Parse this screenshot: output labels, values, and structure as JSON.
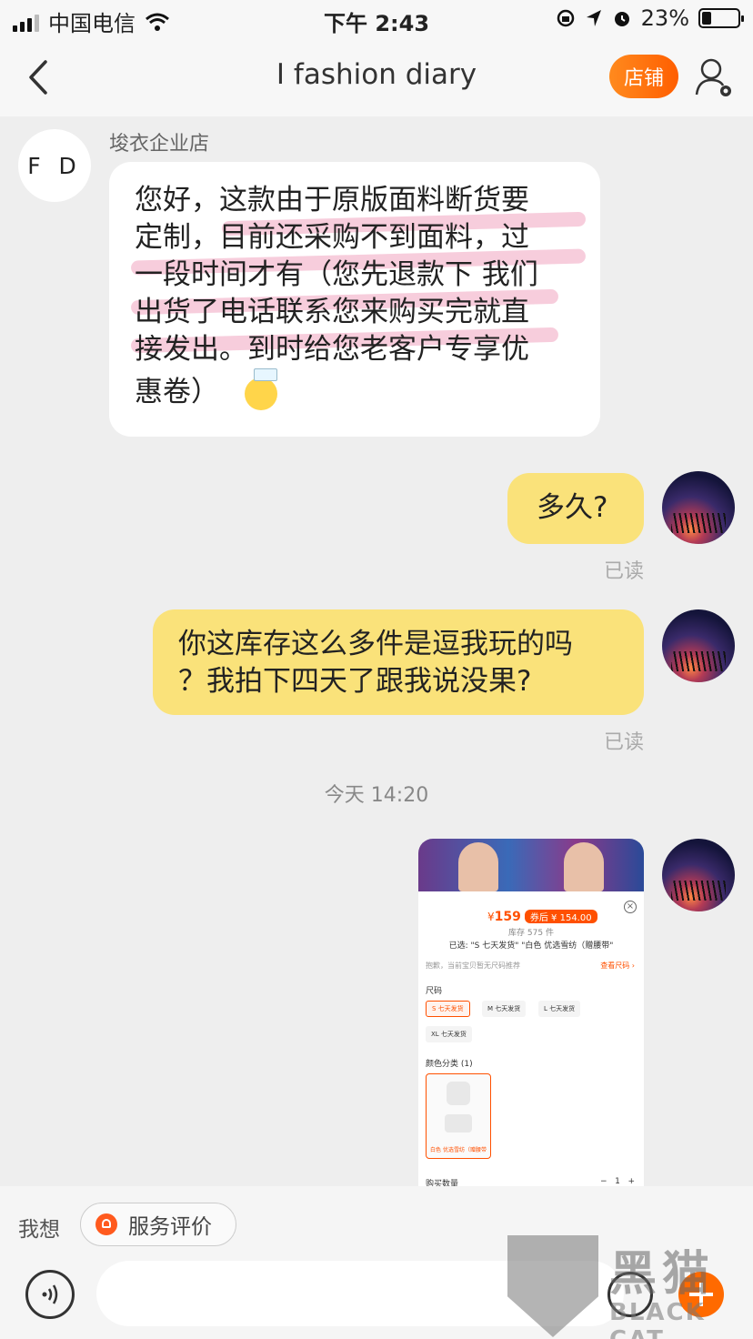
{
  "status_bar": {
    "carrier": "中国电信",
    "time": "下午 2:43",
    "battery": "23%"
  },
  "header": {
    "title": "I fashion diary",
    "shop_button": "店铺"
  },
  "messages": {
    "seller_avatar_text": "F D",
    "seller_name": "埈衣企业店",
    "seller_message_lines": [
      "您好，这款由于原版面料断货要",
      "定制，目前还采购不到面料，过",
      "一段时间才有（您先退款下 我们",
      "出货了电话联系您来购买完就直",
      "接发出。到时给您老客户专享优",
      "惠卷）"
    ],
    "reply1": "多久?",
    "reply1_status": "已读",
    "reply2_lines": [
      "你这库存这么多件是逗我玩的吗",
      "？我拍下四天了跟我说没果?"
    ],
    "reply2_status": "已读",
    "time_separator": "今天 14:20"
  },
  "product_card": {
    "price_symbol": "¥",
    "price": "159",
    "coupon_tag": "券后 ¥ 154.00",
    "stock": "库存 575 件",
    "selected": "已选: \"S 七天发货\" \"白色 优选雪纺（赠腰带\"",
    "no_size_note": "抱歉，当前宝贝暂无尺码推荐",
    "size_chart": "查看尺码 ›",
    "size_label": "尺码",
    "sizes": [
      "S 七天发货",
      "M 七天发货",
      "L 七天发货",
      "XL 七天发货"
    ],
    "color_label": "颜色分类 (1)",
    "color_option": "白色 优选雪纺（赠腰带",
    "quantity_label": "购买数量",
    "quantity": "1"
  },
  "bottom_bar": {
    "want_label": "我想",
    "service_button": "服务评价"
  },
  "watermark": {
    "cn": "黑猫",
    "en": "BLACK CAT"
  },
  "colors": {
    "accent": "#ff5000",
    "my_bubble": "#fae27a",
    "background": "#eeeeee"
  }
}
